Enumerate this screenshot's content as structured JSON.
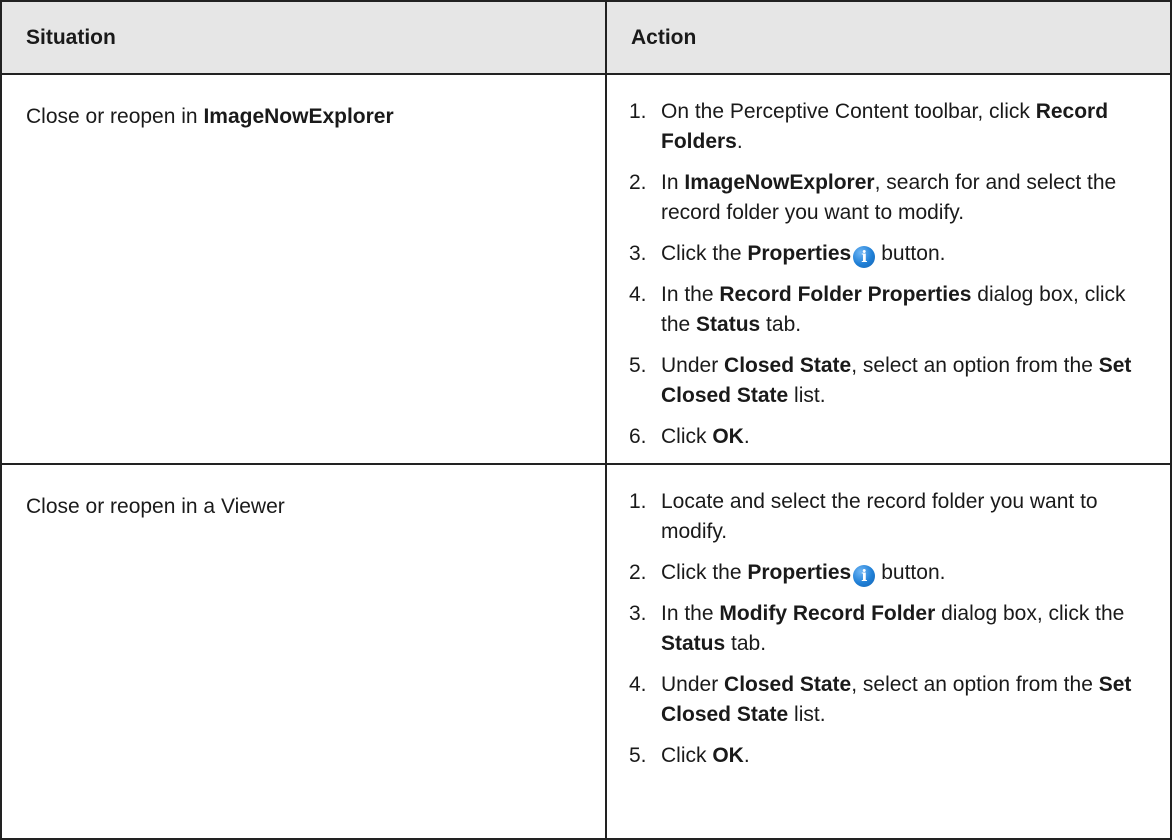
{
  "header": {
    "situation": "Situation",
    "action": "Action"
  },
  "rows": [
    {
      "situation_prefix": "Close or reopen in ",
      "situation_bold": "ImageNowExplorer",
      "steps": [
        {
          "n": "1.",
          "parts": [
            {
              "t": "On the Perceptive Content toolbar, click "
            },
            {
              "t": "Record Folders",
              "b": true
            },
            {
              "t": "."
            }
          ]
        },
        {
          "n": "2.",
          "parts": [
            {
              "t": "In "
            },
            {
              "t": "ImageNowExplorer",
              "b": true
            },
            {
              "t": ", search for and select the record folder you want to modify."
            }
          ]
        },
        {
          "n": "3.",
          "parts": [
            {
              "t": "Click the "
            },
            {
              "t": "Properties",
              "b": true
            },
            {
              "icon": "info-icon",
              "glyph": "i"
            },
            {
              "t": "button."
            }
          ]
        },
        {
          "n": "4.",
          "parts": [
            {
              "t": "In the "
            },
            {
              "t": "Record Folder Properties",
              "b": true
            },
            {
              "t": " dialog box, click the "
            },
            {
              "t": "Status",
              "b": true
            },
            {
              "t": " tab."
            }
          ]
        },
        {
          "n": "5.",
          "parts": [
            {
              "t": "Under "
            },
            {
              "t": "Closed State",
              "b": true
            },
            {
              "t": ", select an option from the "
            },
            {
              "t": "Set Closed State",
              "b": true
            },
            {
              "t": " list."
            }
          ]
        },
        {
          "n": "6.",
          "parts": [
            {
              "t": "Click "
            },
            {
              "t": "OK",
              "b": true
            },
            {
              "t": "."
            }
          ]
        }
      ]
    },
    {
      "situation_prefix": "Close or reopen in a Viewer",
      "situation_bold": "",
      "steps": [
        {
          "n": "1.",
          "parts": [
            {
              "t": "Locate and select the record folder you want to modify."
            }
          ]
        },
        {
          "n": "2.",
          "parts": [
            {
              "t": "Click the "
            },
            {
              "t": "Properties",
              "b": true
            },
            {
              "icon": "info-icon",
              "glyph": "i"
            },
            {
              "t": "button."
            }
          ]
        },
        {
          "n": "3.",
          "parts": [
            {
              "t": "In the "
            },
            {
              "t": "Modify Record Folder",
              "b": true
            },
            {
              "t": " dialog box, click the "
            },
            {
              "t": "Status",
              "b": true
            },
            {
              "t": " tab."
            }
          ]
        },
        {
          "n": "4.",
          "parts": [
            {
              "t": "Under "
            },
            {
              "t": "Closed State",
              "b": true
            },
            {
              "t": ", select an option from the "
            },
            {
              "t": "Set Closed State",
              "b": true
            },
            {
              "t": " list."
            }
          ]
        },
        {
          "n": "5.",
          "parts": [
            {
              "t": "Click "
            },
            {
              "t": "OK",
              "b": true
            },
            {
              "t": "."
            }
          ]
        }
      ]
    }
  ]
}
